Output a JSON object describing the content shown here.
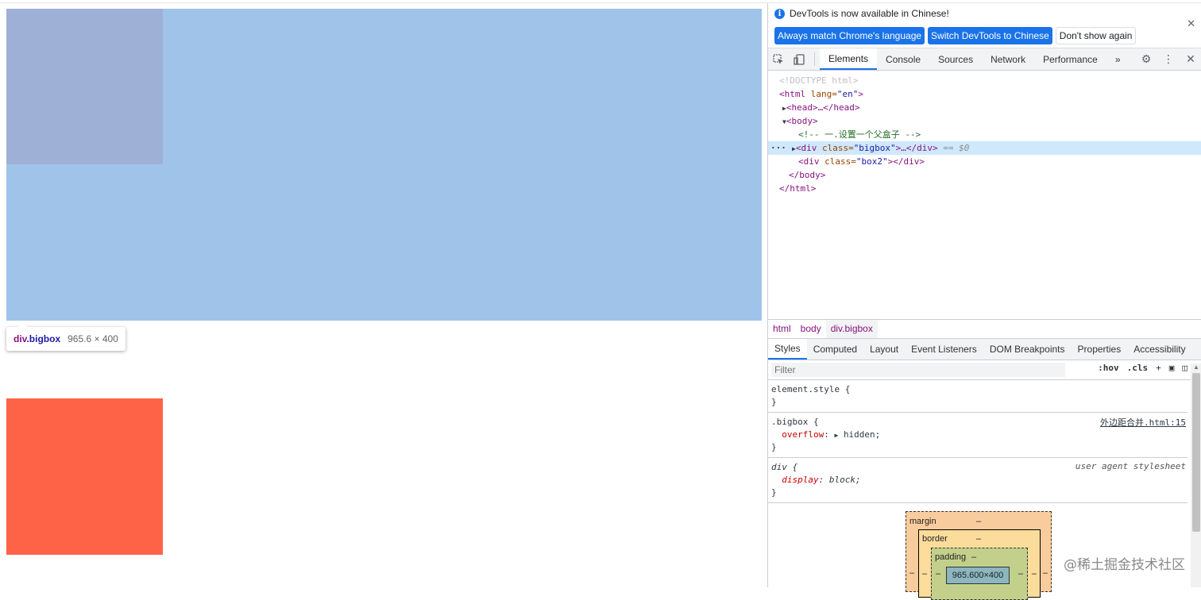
{
  "page": {
    "tooltip": {
      "tag": "div",
      "cls": ".bigbox",
      "size": "965.6 × 400"
    },
    "colors": {
      "bigbox": "#a0c4e9",
      "inner": "#9fb0d6",
      "box2": "#ff6347"
    }
  },
  "infobar": {
    "message": "DevTools is now available in Chinese!",
    "btn_match": "Always match Chrome's language",
    "btn_switch": "Switch DevTools to Chinese",
    "btn_dont": "Don't show again"
  },
  "tabs": [
    "Elements",
    "Console",
    "Sources",
    "Network",
    "Performance"
  ],
  "elements": {
    "doctype": "<!DOCTYPE html>",
    "html_open": "<html",
    "html_attr": " lang=",
    "html_val": "\"en\"",
    "head": "<head>…</head>",
    "body_open": "<body>",
    "comment": "<!-- 一.设置一个父盒子 -->",
    "bigbox_tag": "<div",
    "class_attr": " class=",
    "bigbox_val": "\"bigbox\"",
    "bigbox_rest": ">…</div>",
    "dollar": " == $0",
    "box2_val": "\"box2\"",
    "box2_rest": "></div>",
    "body_close": "</body>",
    "html_close": "</html>"
  },
  "breadcrumbs": [
    "html",
    "body",
    "div.bigbox"
  ],
  "subtabs": [
    "Styles",
    "Computed",
    "Layout",
    "Event Listeners",
    "DOM Breakpoints",
    "Properties",
    "Accessibility"
  ],
  "filter": {
    "placeholder": "Filter",
    "hov": ":hov",
    "cls": ".cls"
  },
  "styles": {
    "element_style": "element.style {",
    "close": "}",
    "bigbox_selector": ".bigbox {",
    "bigbox_source": "外边距合并.html:15",
    "overflow_prop": "overflow",
    "overflow_val": "hidden;",
    "div_selector": "div {",
    "div_source": "user agent stylesheet",
    "display_prop": "display",
    "display_val": "block;"
  },
  "boxmodel": {
    "margin": "margin",
    "border": "border",
    "padding": "padding",
    "dash": "–",
    "content": "965.600×400"
  },
  "watermark": "@稀土掘金技术社区"
}
